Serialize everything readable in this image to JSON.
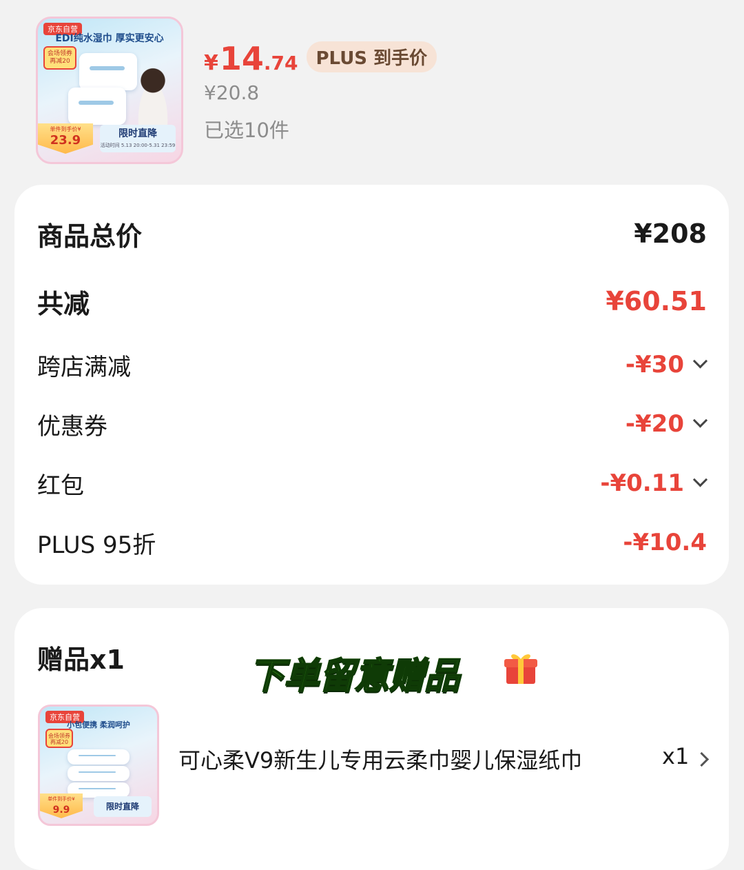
{
  "product": {
    "image_texts": {
      "brand": "京东自营",
      "title": "EDI纯水湿巾  厚实更安心",
      "coupon": "会场领券再减20",
      "badge_small": "单件到手价¥",
      "badge_big": "23.9",
      "limited": "限时直降",
      "limited_time": "活动时间 5.13 20:00-5.31 23:59"
    },
    "price_symbol": "¥",
    "price_int": "14",
    "price_dec": ".74",
    "plus_tag": "PLUS 到手价",
    "original_price": "¥20.8",
    "selected_qty": "已选10件"
  },
  "summary": {
    "total_label": "商品总价",
    "total_value": "¥208",
    "discount_label": "共减",
    "discount_value": "¥60.51",
    "items": [
      {
        "label": "跨店满减",
        "value": "-¥30",
        "expandable": true
      },
      {
        "label": "优惠券",
        "value": "-¥20",
        "expandable": true
      },
      {
        "label": "红包",
        "value": "-¥0.11",
        "expandable": true
      },
      {
        "label": "PLUS 95折",
        "value": "-¥10.4",
        "expandable": false
      }
    ]
  },
  "gift": {
    "title": "赠品x1",
    "banner": "下单留意赠品",
    "image_texts": {
      "brand": "京东自营",
      "title": "小包便携  柔润呵护",
      "coupon": "会场领券再减20",
      "badge_small": "单件到手价¥",
      "badge_big": "9.9",
      "limited": "限时直降"
    },
    "name": "可心柔V9新生儿专用云柔巾婴儿保湿纸巾",
    "qty": "x1"
  },
  "colors": {
    "accent_red": "#e8443a",
    "plus_tag_bg": "#f7e3d6",
    "background": "#f2f2f2"
  }
}
